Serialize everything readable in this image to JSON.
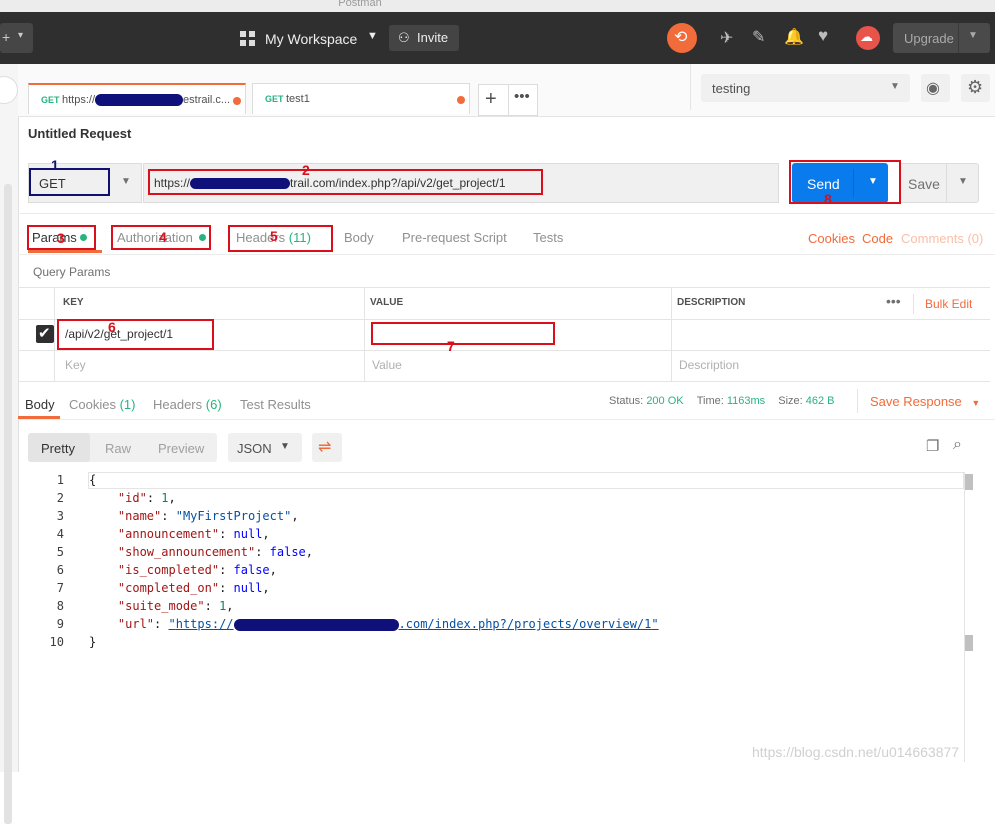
{
  "window": {
    "title": "Postman"
  },
  "header": {
    "workspace": "My Workspace",
    "invite": "Invite",
    "upgrade": "Upgrade"
  },
  "tabs": [
    {
      "method": "GET",
      "url": "https://",
      "suffix": "estrail.c..."
    },
    {
      "method": "GET",
      "url": "test1"
    }
  ],
  "environment": {
    "selected": "testing"
  },
  "request": {
    "title": "Untitled Request",
    "method": "GET",
    "url_prefix": "https://",
    "url_suffix": "trail.com/index.php?/api/v2/get_project/1",
    "send": "Send",
    "save": "Save"
  },
  "req_tabs": {
    "params": "Params",
    "authorization": "Authorization",
    "headers": "Headers",
    "headers_count": "(11)",
    "body": "Body",
    "prerequest": "Pre-request Script",
    "tests": "Tests",
    "cookies": "Cookies",
    "code": "Code",
    "comments": "Comments (0)"
  },
  "params": {
    "section": "Query Params",
    "cols": {
      "key": "KEY",
      "value": "VALUE",
      "description": "DESCRIPTION"
    },
    "bulk_edit": "Bulk Edit",
    "row_key": "/api/v2/get_project/1",
    "ph_key": "Key",
    "ph_value": "Value",
    "ph_description": "Description"
  },
  "response": {
    "tabs": {
      "body": "Body",
      "cookies": "Cookies",
      "cookies_count": "(1)",
      "headers": "Headers",
      "headers_count": "(6)",
      "tests": "Test Results"
    },
    "status_label": "Status:",
    "status": "200 OK",
    "time_label": "Time:",
    "time": "1163ms",
    "size_label": "Size:",
    "size": "462 B",
    "save_response": "Save Response",
    "views": {
      "pretty": "Pretty",
      "raw": "Raw",
      "preview": "Preview",
      "format": "JSON"
    },
    "json_url_prefix": "https://",
    "json_url_suffix": ".com/index.php?/projects/overview/1"
  },
  "annotations": [
    "1",
    "2",
    "3",
    "4",
    "5",
    "6",
    "7",
    "8"
  ],
  "watermark": "https://blog.csdn.net/u014663877",
  "colors": {
    "accent": "#f26b3a",
    "send": "#097bed",
    "green": "#26b47f",
    "annotation": "#d9101c"
  }
}
